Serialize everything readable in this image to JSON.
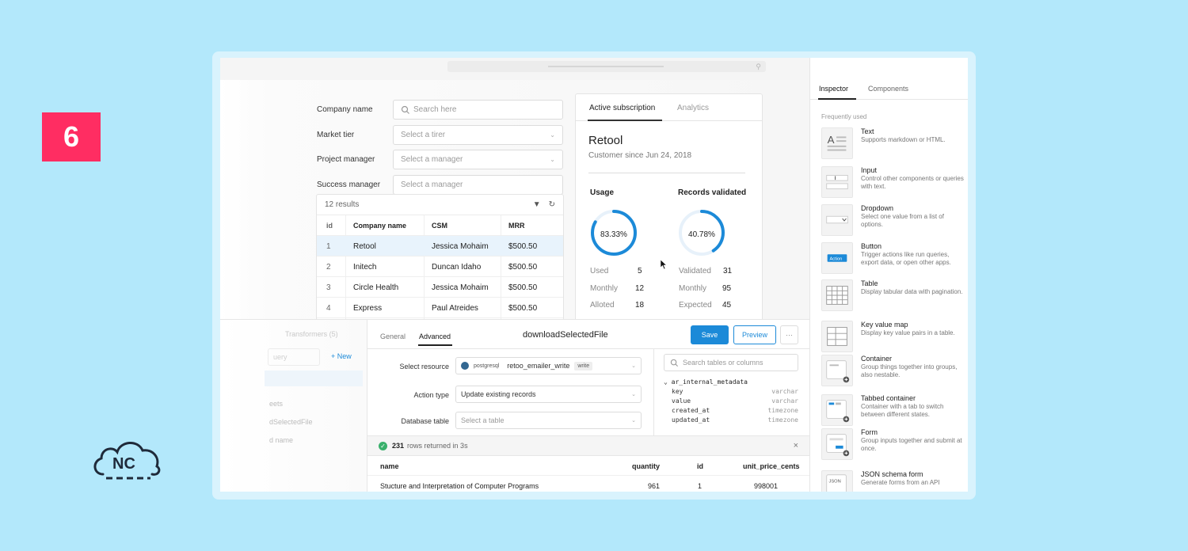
{
  "badge": {
    "number": "6"
  },
  "logo": {
    "text": "NC"
  },
  "form": {
    "company_name": {
      "label": "Company name",
      "placeholder": "Search here"
    },
    "market_tier": {
      "label": "Market tier",
      "placeholder": "Select a tirer"
    },
    "project_manager": {
      "label": "Project manager",
      "placeholder": "Select a manager"
    },
    "success_manager": {
      "label": "Success manager",
      "placeholder": "Select a manager"
    }
  },
  "table": {
    "results": "12 results",
    "columns": [
      "id",
      "Company name",
      "CSM",
      "MRR"
    ],
    "rows": [
      [
        "1",
        "Retool",
        "Jessica Mohaim",
        "$500.50"
      ],
      [
        "2",
        "Initech",
        "Duncan Idaho",
        "$500.50"
      ],
      [
        "3",
        "Circle Health",
        "Jessica Mohaim",
        "$500.50"
      ],
      [
        "4",
        "Express",
        "Paul Atreides",
        "$500.50"
      ]
    ]
  },
  "subscription": {
    "tabs": [
      "Active subscription",
      "Analytics"
    ],
    "customer": "Retool",
    "since": "Customer since Jun 24, 2018",
    "usage": {
      "title": "Usage",
      "percent_label": "83.33%",
      "percent": 83.33,
      "rows": [
        {
          "label": "Used",
          "value": "5"
        },
        {
          "label": "Monthly",
          "value": "12"
        },
        {
          "label": "Alloted",
          "value": "18"
        }
      ]
    },
    "records": {
      "title": "Records validated",
      "percent_label": "40.78%",
      "percent": 40.78,
      "rows": [
        {
          "label": "Validated",
          "value": "31"
        },
        {
          "label": "Monthly",
          "value": "95"
        },
        {
          "label": "Expected",
          "value": "45"
        }
      ]
    },
    "accent": "#1c8ad8"
  },
  "inspector": {
    "tabs": [
      "Inspector",
      "Components"
    ],
    "section": "Frequently used",
    "components": [
      {
        "name": "Text",
        "desc": "Supports markdown or HTML."
      },
      {
        "name": "Input",
        "desc": "Control other components or queries with text."
      },
      {
        "name": "Dropdown",
        "desc": "Select one value from a list of options."
      },
      {
        "name": "Button",
        "desc": "Trigger actions like run queries, export data, or open other apps.",
        "thumb_label": "Action"
      },
      {
        "name": "Table",
        "desc": "Display tabular data with pagination."
      },
      {
        "name": "Key value map",
        "desc": "Display key value pairs in a table."
      },
      {
        "name": "Container",
        "desc": "Group things together into groups, also nestable."
      },
      {
        "name": "Tabbed container",
        "desc": "Container with a tab to switch between different states."
      },
      {
        "name": "Form",
        "desc": "Group inputs together and submit at once."
      },
      {
        "name": "JSON schema form",
        "desc": "Generate forms from an API",
        "thumb_label": "JSON"
      }
    ]
  },
  "left_panel": {
    "title": "Transformers (5)",
    "query_placeholder": "uery",
    "new_label": "+ New",
    "items": [
      "eets",
      "dSelectedFile",
      "d name"
    ]
  },
  "query_editor": {
    "tabs": [
      "General",
      "Advanced"
    ],
    "title": "downloadSelectedFile",
    "save": "Save",
    "preview": "Preview",
    "more": "···",
    "select_resource": {
      "label": "Select resource",
      "db": "postgresql",
      "name": "retoo_emailer_write",
      "mode": "write"
    },
    "action_type": {
      "label": "Action type",
      "value": "Update existing records"
    },
    "database_table": {
      "label": "Database table",
      "placeholder": "Select a table"
    },
    "schema_search": "Search tables or columns",
    "schema": {
      "table": "ar_internal_metadata",
      "columns": [
        {
          "name": "key",
          "type": "varchar"
        },
        {
          "name": "value",
          "type": "varchar"
        },
        {
          "name": "created_at",
          "type": "timezone"
        },
        {
          "name": "updated_at",
          "type": "timezone"
        }
      ]
    },
    "results": {
      "count": "231",
      "text": "rows returned in 3s",
      "close": "×"
    },
    "result_columns": [
      "name",
      "quantity",
      "id",
      "unit_price_cents"
    ],
    "result_rows": [
      [
        "Stucture and Interpretation of Computer Programs",
        "961",
        "1",
        "998001"
      ]
    ]
  }
}
